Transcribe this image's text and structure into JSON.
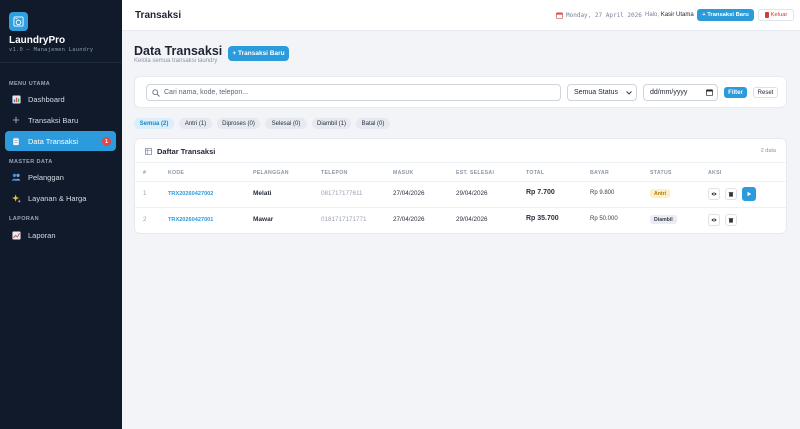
{
  "sidebar": {
    "brand_name": "LaundryPro",
    "brand_version": "v1.0 — Manajemen Laundry",
    "sections": {
      "utama": "MENU UTAMA",
      "master": "MASTER DATA",
      "laporan": "LAPORAN"
    },
    "items": [
      {
        "label": "Dashboard",
        "icon": "chart-icon"
      },
      {
        "label": "Transaksi Baru",
        "icon": "plus-icon"
      },
      {
        "label": "Data Transaksi",
        "icon": "clipboard-icon",
        "badge": "1"
      },
      {
        "label": "Pelanggan",
        "icon": "users-icon"
      },
      {
        "label": "Layanan & Harga",
        "icon": "sparkle-icon"
      },
      {
        "label": "Laporan",
        "icon": "report-icon"
      }
    ]
  },
  "topbar": {
    "title": "Transaksi",
    "date": "Monday, 27 April 2026",
    "greeting": "Halo,",
    "user": "Kasir Utama",
    "new_button": "+ Transaksi Baru",
    "logout_button": "Keluar"
  },
  "page": {
    "title": "Data Transaksi",
    "subtitle": "Kelola semua transaksi laundry",
    "new_button": "+ Transaksi Baru"
  },
  "filter": {
    "search_placeholder": "Cari nama, kode, telepon...",
    "status_selected": "Semua Status",
    "date_placeholder": "dd/mm/yyyy",
    "filter_button": "Filter",
    "reset_button": "Reset"
  },
  "tabs": [
    "Semua (2)",
    "Antri (1)",
    "Diproses (0)",
    "Selesai (0)",
    "Diambil (1)",
    "Batal (0)"
  ],
  "table": {
    "title": "Daftar Transaksi",
    "count": "2 data",
    "columns": [
      "#",
      "KODE",
      "PELANGGAN",
      "TELEPON",
      "MASUK",
      "EST. SELESAI",
      "TOTAL",
      "BAYAR",
      "STATUS",
      "AKSI"
    ],
    "rows": [
      {
        "no": "1",
        "kode": "TRX20260427002",
        "pelanggan": "Melati",
        "telepon": "081717177611",
        "masuk": "27/04/2026",
        "selesai": "29/04/2026",
        "total": "Rp 7.700",
        "bayar": "Rp 9.800",
        "status": "Antri"
      },
      {
        "no": "2",
        "kode": "TRX20260427001",
        "pelanggan": "Mawar",
        "telepon": "0181717171771",
        "masuk": "27/04/2026",
        "selesai": "29/04/2026",
        "total": "Rp 35.700",
        "bayar": "Rp 50.000",
        "status": "Diambil"
      }
    ]
  },
  "colors": {
    "sidebar_bg": "#111a2b",
    "accent": "#2b9bdb",
    "danger": "#e8454a",
    "badge_antri": "#fdf0c8",
    "badge_diambil": "#e9ecf1"
  }
}
